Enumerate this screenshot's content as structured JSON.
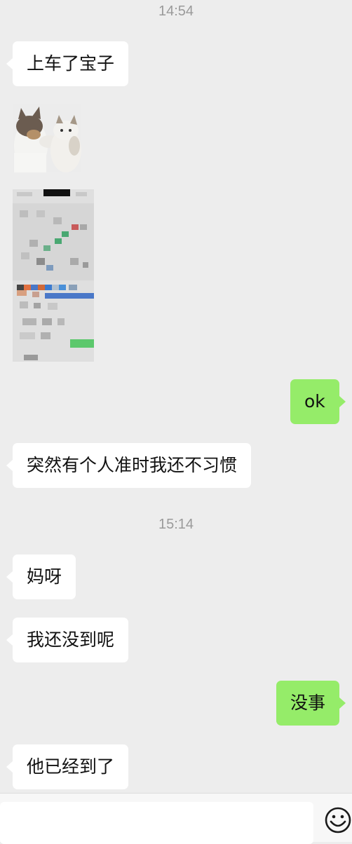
{
  "timestamps": [
    "14:54",
    "15:14"
  ],
  "messages": [
    {
      "side": "left",
      "text": "上车了宝子"
    },
    {
      "side": "right",
      "text": "ok"
    },
    {
      "side": "left",
      "text": "突然有个人准时我还不习惯"
    },
    {
      "side": "left",
      "text": "妈呀"
    },
    {
      "side": "left",
      "text": "我还没到呢"
    },
    {
      "side": "right",
      "text": "没事"
    },
    {
      "side": "left",
      "text": "他已经到了"
    }
  ],
  "media": {
    "sticker_icon": "two-cats-sticker",
    "screenshot_icon": "pixelated-map-screenshot"
  },
  "input": {
    "placeholder": "",
    "value": ""
  },
  "icons": {
    "emoji_button": "smiley-face-icon"
  },
  "colors": {
    "background": "#ededed",
    "incoming_bubble": "#ffffff",
    "outgoing_bubble": "#95ec69",
    "timestamp": "#9a9a9a"
  }
}
